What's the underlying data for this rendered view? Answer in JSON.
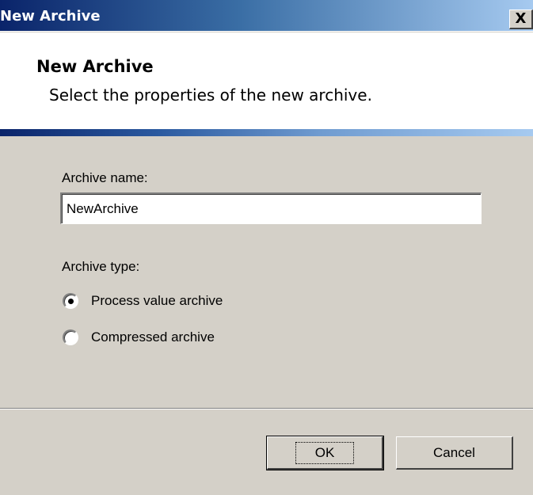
{
  "window": {
    "title": "New Archive",
    "close_label": "X"
  },
  "header": {
    "title": "New Archive",
    "subtitle": "Select the properties of the new archive."
  },
  "form": {
    "name_label": "Archive name:",
    "name_value": "NewArchive",
    "type_label": "Archive type:",
    "type_options": [
      {
        "label": "Process value archive",
        "selected": true
      },
      {
        "label": "Compressed archive",
        "selected": false
      }
    ]
  },
  "buttons": {
    "ok_label": "OK",
    "cancel_label": "Cancel"
  },
  "colors": {
    "titlebar_start": "#0a246a",
    "titlebar_end": "#a6caf0",
    "dialog_bg": "#d4d0c8"
  }
}
